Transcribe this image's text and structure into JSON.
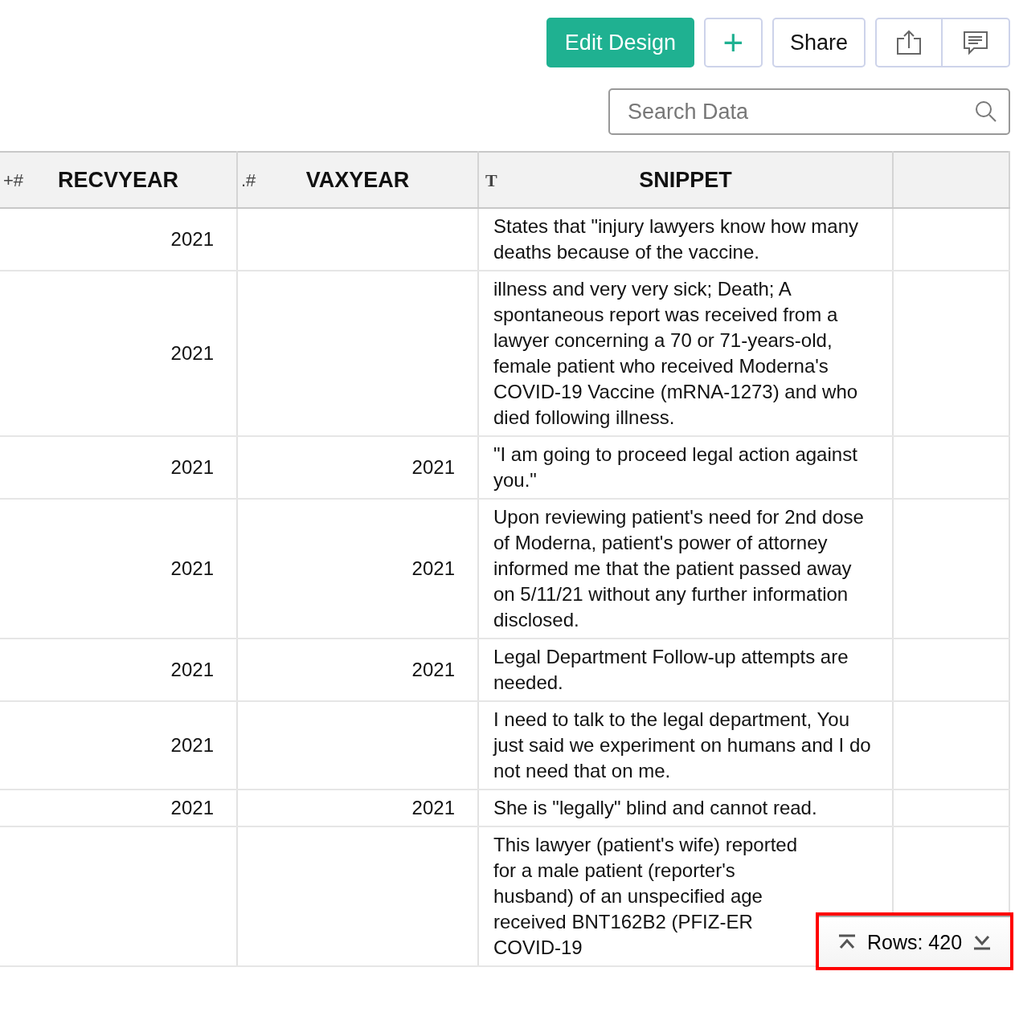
{
  "toolbar": {
    "buttons": [
      {
        "kind": "primary",
        "label": "Edit Design"
      },
      {
        "kind": "add",
        "label": "+"
      },
      {
        "kind": "text",
        "label": "Share"
      },
      {
        "kind": "export"
      },
      {
        "kind": "comment"
      }
    ]
  },
  "search": {
    "placeholder": "Search Data"
  },
  "table": {
    "columns": [
      {
        "type_symbol": "+#",
        "label": "RECVYEAR"
      },
      {
        "type_symbol": ".#",
        "label": "VAXYEAR"
      },
      {
        "type_symbol": "T",
        "label": "SNIPPET"
      }
    ],
    "rows": [
      [
        "2021",
        "",
        "States that \"injury lawyers know how many deaths because of the vaccine."
      ],
      [
        "2021",
        "",
        "illness and very very sick; Death; A spontaneous report was received from a lawyer concerning a 70 or 71-years-old, female patient who received Moderna's COVID-19 Vaccine (mRNA-1273) and who died following illness."
      ],
      [
        "2021",
        "2021",
        "\"I am going to proceed legal action against you.\""
      ],
      [
        "2021",
        "2021",
        "Upon reviewing patient's need for 2nd dose of Moderna, patient's power of attorney informed me that the patient passed away on 5/11/21 without any further information disclosed."
      ],
      [
        "2021",
        "2021",
        "Legal Department  Follow-up attempts are needed."
      ],
      [
        "2021",
        "",
        "I need to talk to the legal department, You just said we experiment on humans and I do not need that on me."
      ],
      [
        "2021",
        "2021",
        "She is \"legally\" blind and cannot read."
      ],
      [
        "",
        "",
        "This lawyer (patient's wife) reported for a male patient (reporter's husband) of an unspecified age received BNT162B2 (PFIZ-ER COVID-19"
      ]
    ]
  },
  "rows_counter": {
    "label": "Rows: 420",
    "highlighted": true
  }
}
